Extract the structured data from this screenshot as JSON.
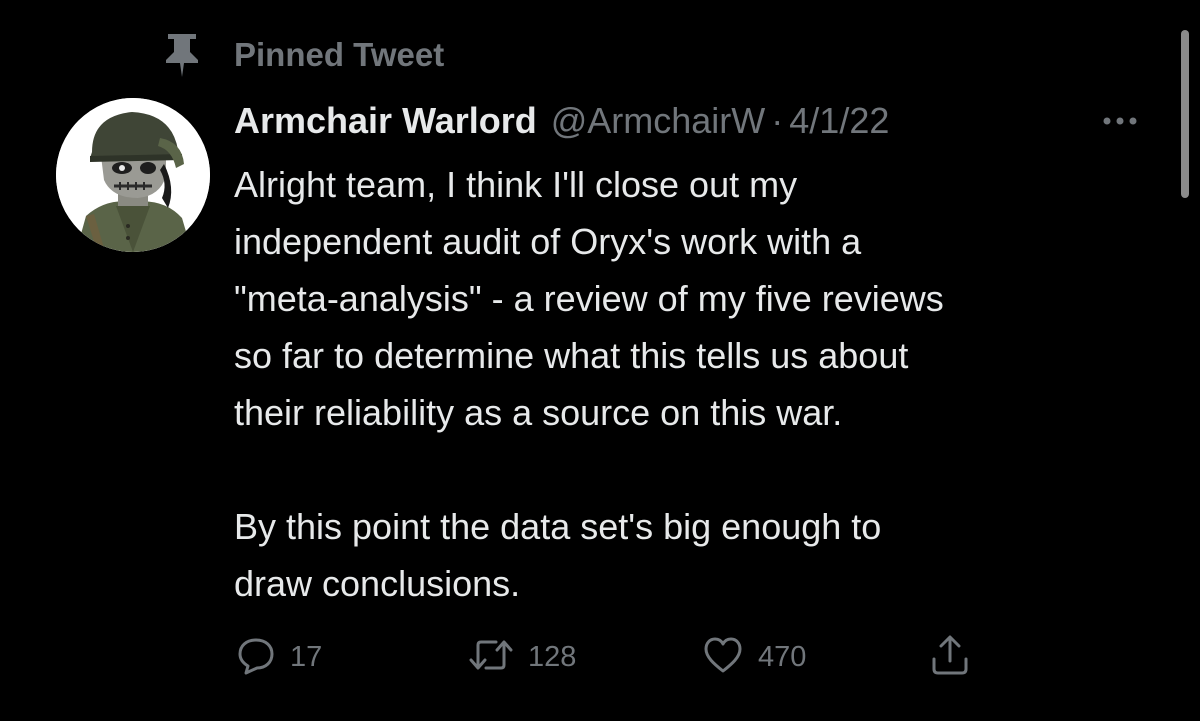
{
  "pinned": {
    "label": "Pinned Tweet",
    "icon": "pin-icon"
  },
  "tweet": {
    "author": {
      "display_name": "Armchair Warlord",
      "handle": "@ArmchairW",
      "avatar": "avatar-illustration"
    },
    "separator": "·",
    "date": "4/1/22",
    "body": {
      "paragraph1": "Alright team, I think I'll close out my\nindependent audit of Oryx's work with a\n\"meta-analysis\" - a review of my five reviews\nso far to determine what this tells us about\ntheir reliability as a source on this war.",
      "paragraph2": "By this point the data set's big enough to\ndraw conclusions."
    },
    "actions": {
      "reply": {
        "icon": "reply-icon",
        "count": "17"
      },
      "retweet": {
        "icon": "retweet-icon",
        "count": "128"
      },
      "like": {
        "icon": "heart-icon",
        "count": "470"
      },
      "share": {
        "icon": "share-icon"
      }
    }
  },
  "colors": {
    "background": "#000000",
    "primary_text": "#e7e9ea",
    "secondary_text": "#71767b"
  }
}
